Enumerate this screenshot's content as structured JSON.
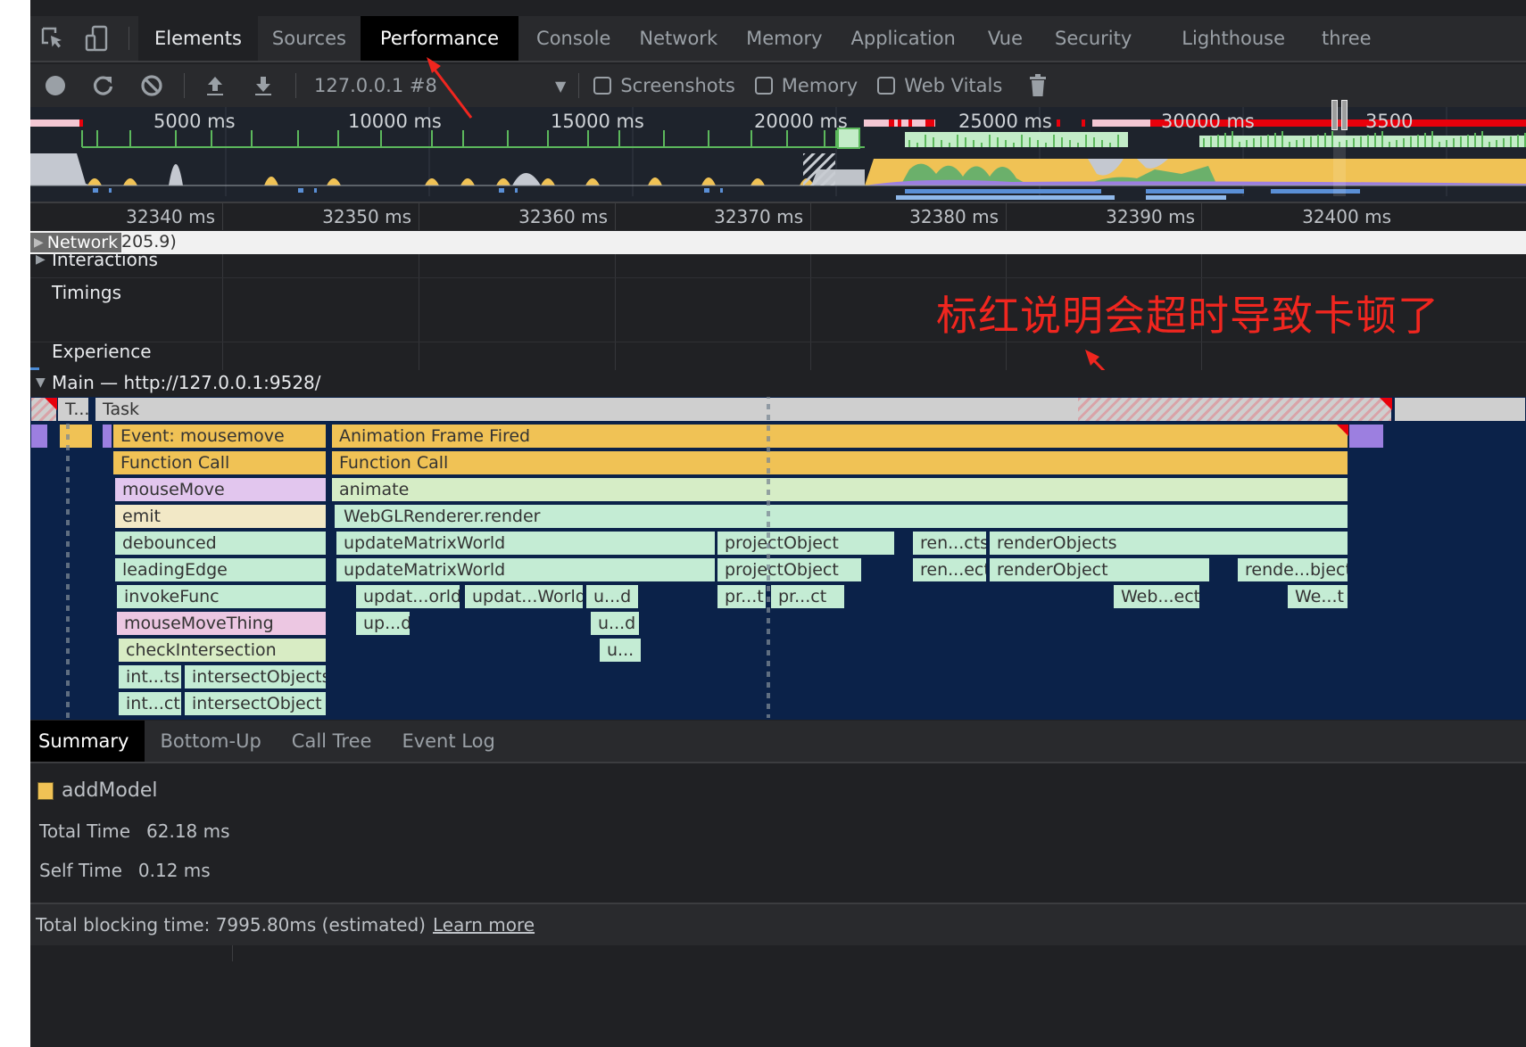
{
  "devtools": {
    "tabs": [
      {
        "label": "Elements",
        "active": false
      },
      {
        "label": "Sources",
        "active": false
      },
      {
        "label": "Performance",
        "active": true
      },
      {
        "label": "Console",
        "active": false
      },
      {
        "label": "Network",
        "active": false
      },
      {
        "label": "Memory",
        "active": false
      },
      {
        "label": "Application",
        "active": false
      },
      {
        "label": "Vue",
        "active": false
      },
      {
        "label": "Security",
        "active": false
      },
      {
        "label": "Lighthouse",
        "active": false
      },
      {
        "label": "three",
        "active": false
      }
    ],
    "icons": {
      "inspect": "inspect-element-icon",
      "device": "device-toolbar-icon"
    }
  },
  "toolbar": {
    "icons": [
      "record-icon",
      "reload-icon",
      "clear-icon",
      "upload-icon",
      "download-icon"
    ],
    "profile_select": "127.0.0.1 #8",
    "dropdown_glyph": "▼",
    "checkboxes": [
      {
        "label": "Screenshots",
        "checked": false
      },
      {
        "label": "Memory",
        "checked": false
      },
      {
        "label": "Web Vitals",
        "checked": false
      }
    ],
    "trash_icon": "garbage-collect-icon"
  },
  "overview": {
    "tick_labels": [
      "5000 ms",
      "10000 ms",
      "15000 ms",
      "20000 ms",
      "25000 ms",
      "30000 ms",
      "3500"
    ],
    "colors": {
      "long_task_red": "#e8000b",
      "task_pink": "#f3c7d3",
      "fps_green": "#5cb85c",
      "fps_fill": "#c3ecc8",
      "cpu_scripting": "#f0c255",
      "cpu_idle": "#c4c8d0",
      "cpu_rendering": "#9c7fe0",
      "cpu_painting": "#6bb06b",
      "network": "#5a8fd6"
    }
  },
  "ruler": {
    "labels": [
      "32340 ms",
      "32350 ms",
      "32360 ms",
      "32370 ms",
      "32380 ms",
      "32390 ms",
      "32400 ms"
    ]
  },
  "tracks": {
    "network": {
      "label": "Network",
      "value": "205.9)"
    },
    "interactions": "Interactions",
    "timings": "Timings",
    "experience": "Experience",
    "main": "Main — http://127.0.0.1:9528/"
  },
  "annotation": {
    "text": "标红说明会超时导致卡顿了",
    "color": "#f0261f"
  },
  "flame": {
    "task_rows": {
      "short": "T...",
      "main": "Task"
    },
    "left_stack": [
      "Event: mousemove",
      "Function Call",
      "mouseMove",
      "emit",
      "debounced",
      "leadingEdge",
      "invokeFunc",
      "mouseMoveThing",
      "checkIntersection"
    ],
    "left_split": [
      {
        "a": "int...ts",
        "b": "intersectObjects"
      },
      {
        "a": "int...ct",
        "b": "intersectObject"
      }
    ],
    "right_stack": [
      "Animation Frame Fired",
      "Function Call",
      "animate",
      "WebGLRenderer.render"
    ],
    "row5": [
      "updateMatrixWorld",
      "projectObject",
      "ren...cts",
      "renderObjects"
    ],
    "row6": [
      "updateMatrixWorld",
      "projectObject",
      "ren...ect",
      "renderObject",
      "rende...bject"
    ],
    "row7": [
      "updat...orld",
      "updat...World",
      "u...d",
      "pr...t",
      "pr...ct",
      "Web...ect",
      "We...t"
    ],
    "row8": [
      "up...d",
      "u...d"
    ],
    "row9": [
      "u..."
    ]
  },
  "bottom": {
    "tabs": [
      {
        "label": "Summary",
        "active": true
      },
      {
        "label": "Bottom-Up",
        "active": false
      },
      {
        "label": "Call Tree",
        "active": false
      },
      {
        "label": "Event Log",
        "active": false
      }
    ],
    "summary": {
      "title": "addModel",
      "swatch_color": "#f0c255",
      "rows": [
        {
          "key": "Total Time",
          "value": "62.18 ms"
        },
        {
          "key": "Self Time",
          "value": "0.12 ms"
        }
      ]
    },
    "footer": {
      "text": "Total blocking time: 7995.80ms (estimated)",
      "link": "Learn more"
    }
  }
}
